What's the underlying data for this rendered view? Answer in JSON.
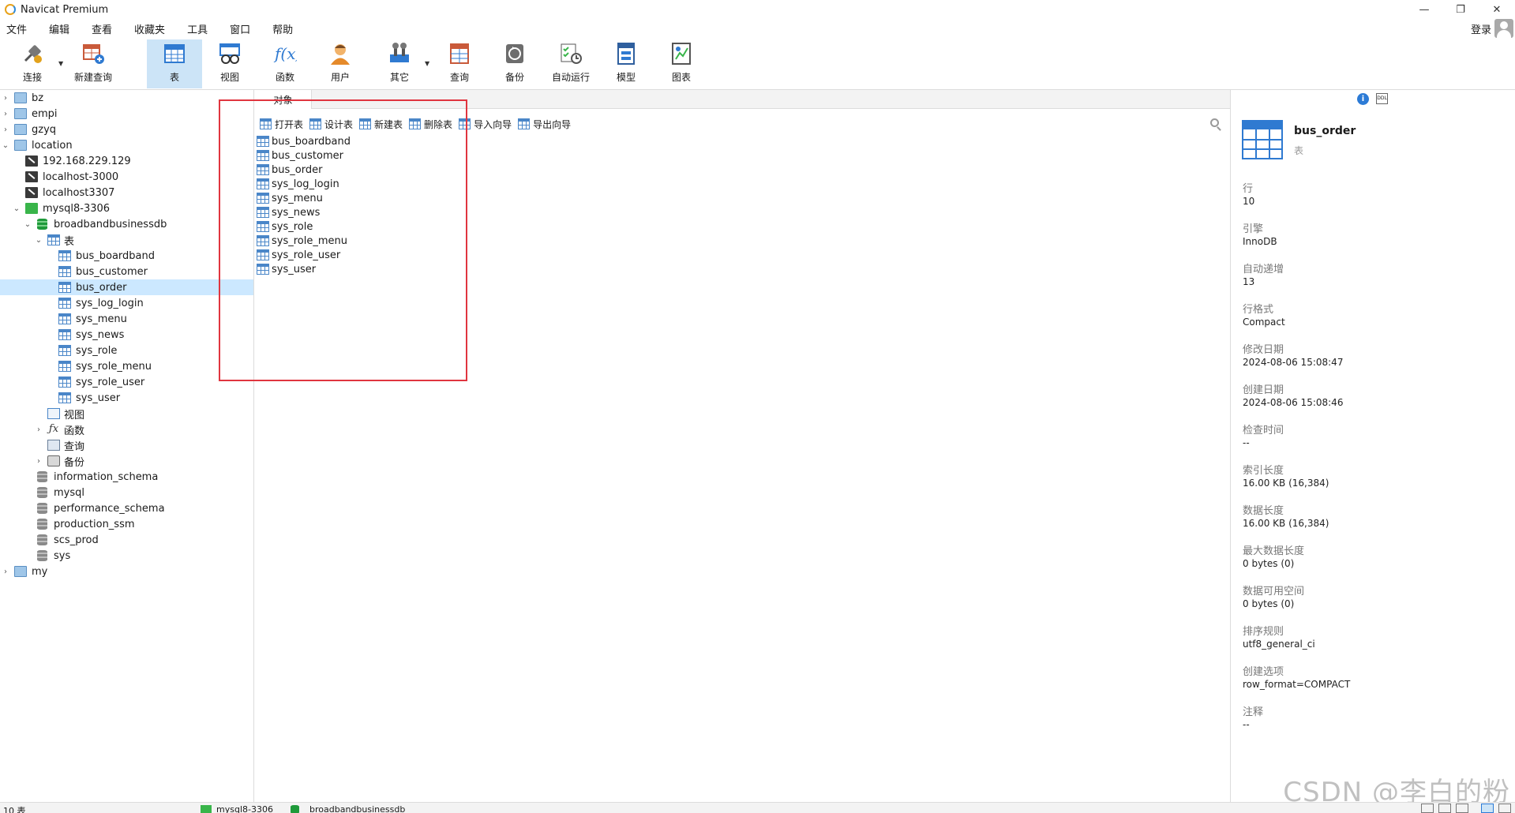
{
  "window": {
    "title": "Navicat Premium",
    "minimize": "—",
    "restore": "❐",
    "close": "✕"
  },
  "menu": [
    "文件",
    "编辑",
    "查看",
    "收藏夹",
    "工具",
    "窗口",
    "帮助"
  ],
  "login_label": "登录",
  "toolbar": {
    "connect": "连接",
    "new_query": "新建查询",
    "table": "表",
    "view": "视图",
    "function": "函数",
    "user": "用户",
    "other": "其它",
    "query": "查询",
    "backup": "备份",
    "autorun": "自动运行",
    "model": "模型",
    "chart": "图表"
  },
  "tree": {
    "connections": [
      "bz",
      "empi",
      "gzyq",
      "location",
      "192.168.229.129",
      "localhost-3000",
      "localhost3307",
      "mysql8-3306"
    ],
    "database": "broadbandbusinessdb",
    "tables_group": "表",
    "tables": [
      "bus_boardband",
      "bus_customer",
      "bus_order",
      "sys_log_login",
      "sys_menu",
      "sys_news",
      "sys_role",
      "sys_role_menu",
      "sys_role_user",
      "sys_user"
    ],
    "views_group": "视图",
    "functions_group": "函数",
    "queries_group": "查询",
    "backups_group": "备份",
    "other_dbs": [
      "information_schema",
      "mysql",
      "performance_schema",
      "production_ssm",
      "scs_prod",
      "sys"
    ],
    "last_group": "my"
  },
  "objects_tab": "对象",
  "obj_toolbar": {
    "open": "打开表",
    "design": "设计表",
    "new": "新建表",
    "delete": "删除表",
    "import": "导入向导",
    "export": "导出向导"
  },
  "objects": [
    "bus_boardband",
    "bus_customer",
    "bus_order",
    "sys_log_login",
    "sys_menu",
    "sys_news",
    "sys_role",
    "sys_role_menu",
    "sys_role_user",
    "sys_user"
  ],
  "info": {
    "icon_ddl": "DDL",
    "icon_info": "i",
    "name": "bus_order",
    "type": "表",
    "fields": [
      {
        "label": "行",
        "value": "10"
      },
      {
        "label": "引擎",
        "value": "InnoDB"
      },
      {
        "label": "自动递增",
        "value": "13"
      },
      {
        "label": "行格式",
        "value": "Compact"
      },
      {
        "label": "修改日期",
        "value": "2024-08-06 15:08:47"
      },
      {
        "label": "创建日期",
        "value": "2024-08-06 15:08:46"
      },
      {
        "label": "检查时间",
        "value": "--"
      },
      {
        "label": "索引长度",
        "value": "16.00 KB (16,384)"
      },
      {
        "label": "数据长度",
        "value": "16.00 KB (16,384)"
      },
      {
        "label": "最大数据长度",
        "value": "0 bytes (0)"
      },
      {
        "label": "数据可用空间",
        "value": "0 bytes (0)"
      },
      {
        "label": "排序规则",
        "value": "utf8_general_ci"
      },
      {
        "label": "创建选项",
        "value": "row_format=COMPACT"
      },
      {
        "label": "注释",
        "value": "--"
      }
    ]
  },
  "status": {
    "count": "10 表",
    "connection": "mysql8-3306",
    "database": "broadbandbusinessdb"
  },
  "watermark": "CSDN @李白的粉",
  "colors": {
    "selection": "#cce8ff",
    "toolbar_active": "#cce4f7",
    "highlight_box": "#e0353f"
  }
}
